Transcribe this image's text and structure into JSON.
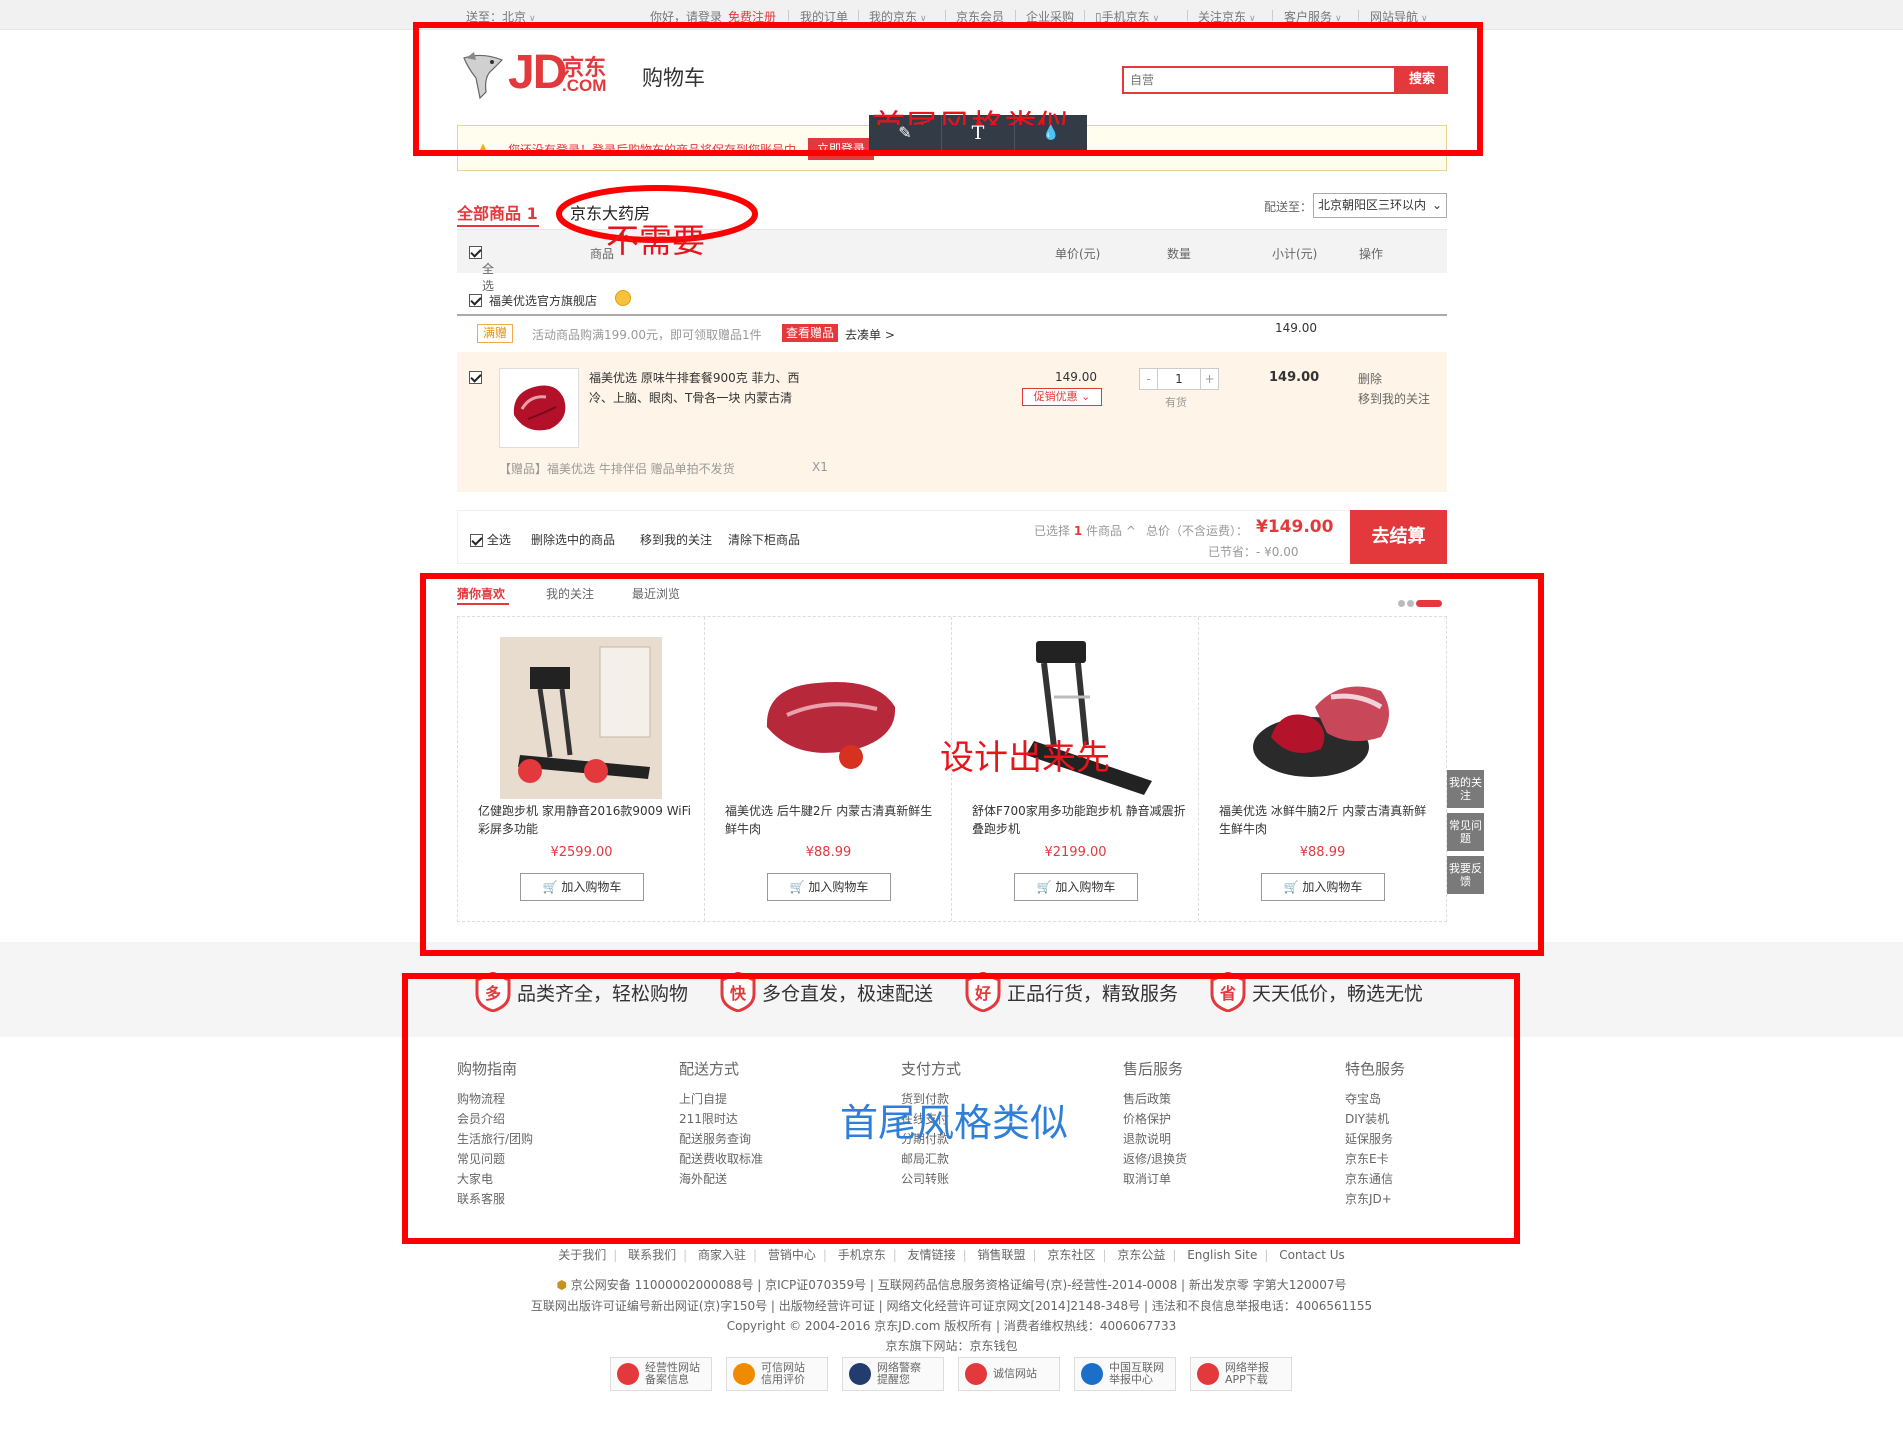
{
  "topbar": {
    "location": "送至：北京",
    "greeting": "你好，请登录",
    "register": "免费注册",
    "items": [
      "我的订单",
      "我的京东",
      "京东会员",
      "企业采购",
      "手机京东",
      "关注京东",
      "客户服务",
      "网站导航"
    ]
  },
  "header": {
    "logo_text": "JD",
    "logo_cn": "京东",
    "logo_com": ".COM",
    "title": "购物车",
    "search_placeholder": "自营",
    "search_button": "搜索"
  },
  "notice": {
    "text": "您还没有登录！登录后购物车的商品将保存到您账号中",
    "button": "立即登录"
  },
  "toolbar": {
    "pencil": "✎",
    "text": "T",
    "drop": "💧"
  },
  "tabs": {
    "all": "全部商品",
    "all_count": "1",
    "pharmacy": "京东大药房"
  },
  "shipping": {
    "label": "配送至：",
    "value": "北京朝阳区三环以内"
  },
  "table_head": {
    "select_all": "全选",
    "product": "商品",
    "unit_price": "单价(元)",
    "quantity": "数量",
    "subtotal": "小计(元)",
    "action": "操作"
  },
  "shop": {
    "name": "福美优选官方旗舰店"
  },
  "promo": {
    "tag": "满赠",
    "desc": "活动商品购满199.00元，即可领取赠品1件",
    "gift_button": "查看赠品",
    "go": "去凑单 >",
    "subtotal": "149.00"
  },
  "cart_item": {
    "name": "福美优选 原味牛排套餐900克 菲力、西冷、上脑、眼肉、T骨各一块 内蒙古清",
    "price": "149.00",
    "promo": "促销优惠",
    "quantity": "1",
    "stock": "有货",
    "sum": "149.00",
    "delete": "删除",
    "move": "移到我的关注",
    "gift": "【赠品】福美优选 牛排伴侣 赠品单拍不发货",
    "gift_qty": "X1"
  },
  "bottom_bar": {
    "select_all": "全选",
    "delete_selected": "删除选中的商品",
    "move_to_follow": "移到我的关注",
    "clear": "清除下柜商品",
    "selected_prefix": "已选择",
    "selected_count": "1",
    "selected_suffix": "件商品",
    "total_label": "总价（不含运费）：",
    "total": "¥149.00",
    "saved": "已节省：- ¥0.00",
    "checkout": "去结算"
  },
  "recommend": {
    "tabs": [
      "猜你喜欢",
      "我的关注",
      "最近浏览"
    ],
    "items": [
      {
        "name": "亿健跑步机 家用静音2016款9009 WiFi彩屏多功能",
        "price": "¥2599.00",
        "button": "加入购物车"
      },
      {
        "name": "福美优选 后牛腱2斤 内蒙古清真新鲜生鲜牛肉",
        "price": "¥88.99",
        "button": "加入购物车"
      },
      {
        "name": "舒体F700家用多功能跑步机 静音减震折叠跑步机",
        "price": "¥2199.00",
        "button": "加入购物车"
      },
      {
        "name": "福美优选 冰鲜牛腩2斤 内蒙古清真新鲜生鲜牛肉",
        "price": "¥88.99",
        "button": "加入购物车"
      }
    ]
  },
  "side_tools": [
    "我的关注",
    "常见问题",
    "我要反馈"
  ],
  "slogans": [
    {
      "icon": "多",
      "text": "品类齐全，轻松购物"
    },
    {
      "icon": "快",
      "text": "多仓直发，极速配送"
    },
    {
      "icon": "好",
      "text": "正品行货，精致服务"
    },
    {
      "icon": "省",
      "text": "天天低价，畅选无忧"
    }
  ],
  "footer_cols": [
    {
      "title": "购物指南",
      "items": [
        "购物流程",
        "会员介绍",
        "生活旅行/团购",
        "常见问题",
        "大家电",
        "联系客服"
      ]
    },
    {
      "title": "配送方式",
      "items": [
        "上门自提",
        "211限时达",
        "配送服务查询",
        "配送费收取标准",
        "海外配送"
      ]
    },
    {
      "title": "支付方式",
      "items": [
        "货到付款",
        "在线支付",
        "分期付款",
        "邮局汇款",
        "公司转账"
      ]
    },
    {
      "title": "售后服务",
      "items": [
        "售后政策",
        "价格保护",
        "退款说明",
        "返修/退换货",
        "取消订单"
      ]
    },
    {
      "title": "特色服务",
      "items": [
        "夺宝岛",
        "DIY装机",
        "延保服务",
        "京东E卡",
        "京东通信",
        "京东JD+"
      ]
    }
  ],
  "footer_links": [
    "关于我们",
    "联系我们",
    "商家入驻",
    "营销中心",
    "手机京东",
    "友情链接",
    "销售联盟",
    "京东社区",
    "京东公益",
    "English Site",
    "Contact Us"
  ],
  "footer_info": [
    "京公网安备 11000002000088号 | 京ICP证070359号 | 互联网药品信息服务资格证编号(京)-经营性-2014-0008 | 新出发京零 字第大120007号",
    "互联网出版许可证编号新出网证(京)字150号 | 出版物经营许可证 | 网络文化经营许可证京网文[2014]2148-348号 | 违法和不良信息举报电话：4006561155",
    "Copyright © 2004-2016 京东JD.com 版权所有 | 消费者维权热线：4006067733",
    "京东旗下网站：京东钱包"
  ],
  "footer_badges": [
    [
      "经营性网站",
      "备案信息"
    ],
    [
      "可信网站",
      "信用评价"
    ],
    [
      "网络警察",
      "提醒您"
    ],
    [
      "诚信网站",
      ""
    ],
    [
      "中国互联网",
      "举报中心"
    ],
    [
      "网络举报",
      "APP下载"
    ]
  ],
  "annotations": {
    "header_note": "首尾风格类似",
    "pharmacy_note": "不需要",
    "recommend_note": "设计出来先",
    "footer_note": "首尾风格类似"
  },
  "colors": {
    "brand_red": "#e4393c",
    "annotation_red": "#ff0000",
    "annotation_blue": "#2f7fd8"
  }
}
